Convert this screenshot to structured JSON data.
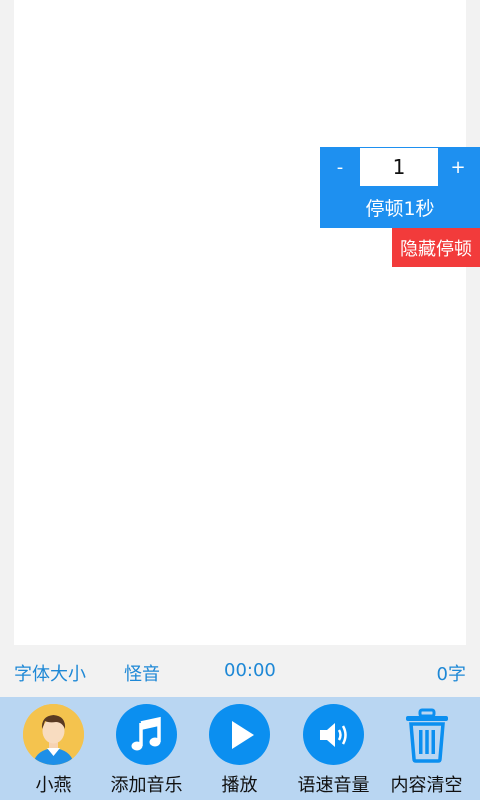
{
  "pause": {
    "minus_label": "-",
    "value": "1",
    "plus_label": "+",
    "insert_label": "停顿1秒",
    "hide_label": "隐藏停顿"
  },
  "status": {
    "font_size_label": "字体大小",
    "voice_effect_label": "怪音",
    "time": "00:00",
    "char_count": "0字"
  },
  "toolbar": {
    "items": [
      {
        "label": "小燕",
        "icon": "avatar-icon"
      },
      {
        "label": "添加音乐",
        "icon": "music-note-icon"
      },
      {
        "label": "播放",
        "icon": "play-icon"
      },
      {
        "label": "语速音量",
        "icon": "speaker-icon"
      },
      {
        "label": "内容清空",
        "icon": "trash-icon"
      }
    ]
  },
  "colors": {
    "accent": "#1e90f0",
    "danger": "#f23b3b",
    "toolbar_bg": "#b9d6f2",
    "status_text": "#1e88d6"
  }
}
